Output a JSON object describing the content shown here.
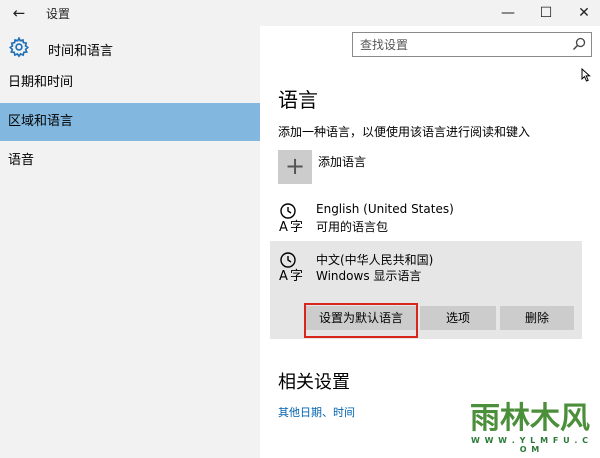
{
  "window": {
    "title": "设置",
    "back_icon": "←",
    "minimize_icon": "—",
    "maximize_icon": "☐",
    "close_icon": "✕"
  },
  "header": {
    "app_title": "时间和语言",
    "icon": "gear-icon"
  },
  "search": {
    "placeholder": "查找设置",
    "icon": "search-icon"
  },
  "sidebar": {
    "items": [
      {
        "label": "日期和时间",
        "selected": false
      },
      {
        "label": "区域和语言",
        "selected": true
      },
      {
        "label": "语音",
        "selected": false
      }
    ]
  },
  "main": {
    "section_title": "语言",
    "description": "添加一种语言，以便使用该语言进行阅读和键入",
    "add_language_label": "添加语言",
    "add_icon": "+",
    "languages": [
      {
        "name": "English (United States)",
        "status": "可用的语言包",
        "icon": "language-icon"
      },
      {
        "name": "中文(中华人民共和国)",
        "status": "Windows 显示语言",
        "icon": "language-icon"
      }
    ],
    "buttons": {
      "set_default": "设置为默认语言",
      "options": "选项",
      "remove": "删除"
    },
    "related_title": "相关设置",
    "related_link": "其他日期、时间"
  },
  "watermark": {
    "brand": "雨林木风",
    "url": "W W W . Y L M F U . C O M"
  },
  "colors": {
    "sidebar_bg": "#f2f2f2",
    "selected_bg": "#82b8e0",
    "button_bg": "#cccccc",
    "highlight_border": "#d9261c",
    "link": "#0063b1"
  }
}
